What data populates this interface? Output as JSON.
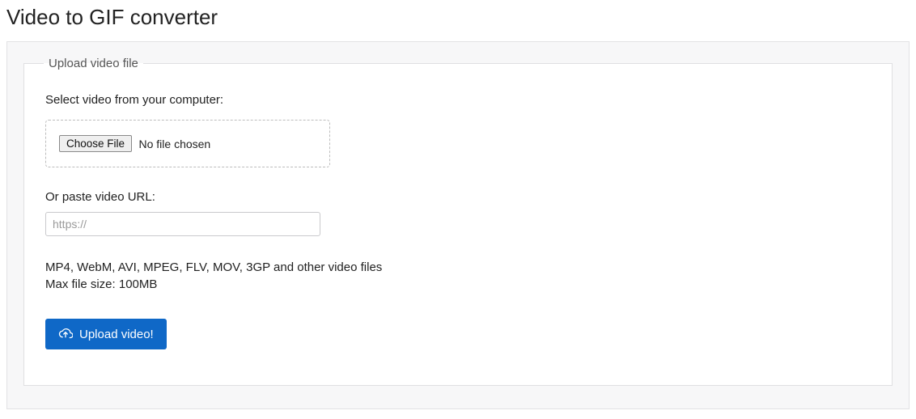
{
  "title": "Video to GIF converter",
  "fieldset_legend": "Upload video file",
  "select_label": "Select video from your computer:",
  "choose_file_label": "Choose File",
  "file_status": "No file chosen",
  "url_label": "Or paste video URL:",
  "url_placeholder": "https://",
  "formats_text": "MP4, WebM, AVI, MPEG, FLV, MOV, 3GP and other video files",
  "max_size_text": "Max file size: 100MB",
  "upload_button_label": "Upload video!"
}
